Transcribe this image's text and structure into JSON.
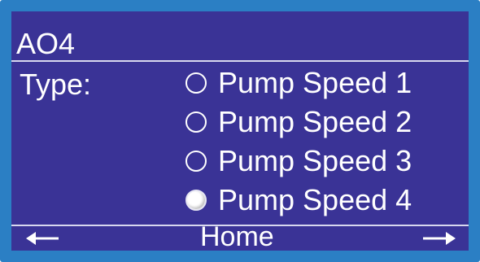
{
  "screen": {
    "title": "AO4",
    "type_label": "Type:",
    "options": [
      {
        "label": "Pump Speed 1",
        "selected": false
      },
      {
        "label": "Pump Speed 2",
        "selected": false
      },
      {
        "label": "Pump Speed 3",
        "selected": false
      },
      {
        "label": "Pump Speed 4",
        "selected": true
      }
    ]
  },
  "footer": {
    "home_label": "Home",
    "left_icon": "arrow-left-icon",
    "right_icon": "arrow-right-icon"
  },
  "colors": {
    "frame": "#2b7fc4",
    "screen_background": "#3a3396",
    "text": "#ffffff"
  }
}
